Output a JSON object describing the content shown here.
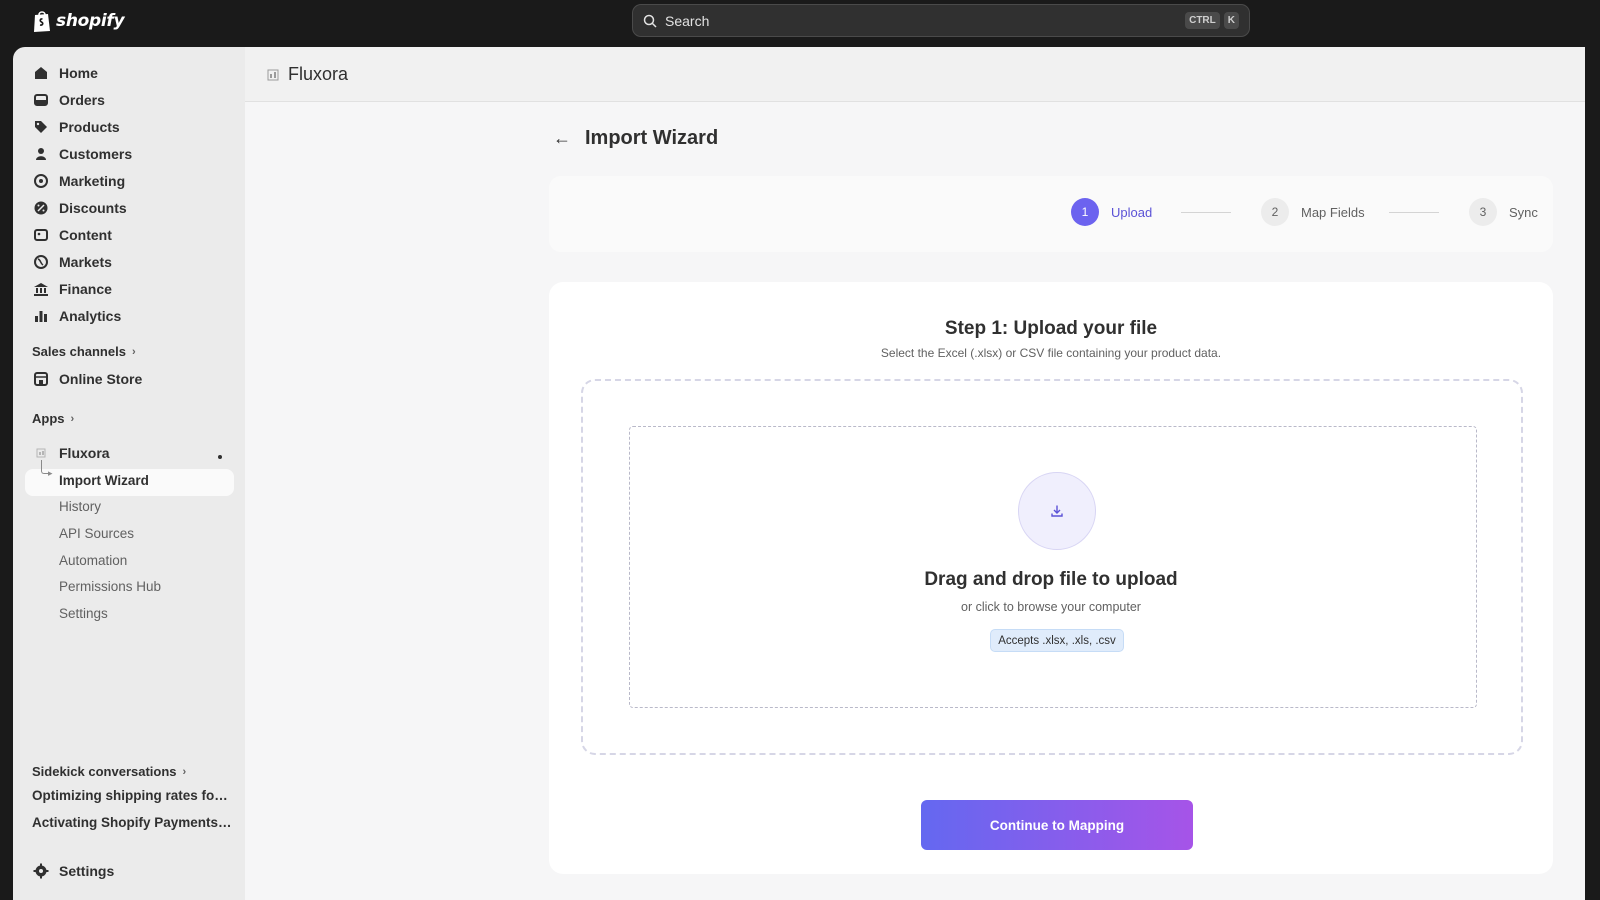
{
  "topbar": {
    "logo_text": "shopify",
    "search_placeholder": "Search",
    "shortcut_keys": [
      "CTRL",
      "K"
    ]
  },
  "sidebar": {
    "nav": [
      {
        "label": "Home",
        "icon": "home-icon"
      },
      {
        "label": "Orders",
        "icon": "orders-icon"
      },
      {
        "label": "Products",
        "icon": "tag-icon"
      },
      {
        "label": "Customers",
        "icon": "person-icon"
      },
      {
        "label": "Marketing",
        "icon": "target-icon"
      },
      {
        "label": "Discounts",
        "icon": "discount-icon"
      },
      {
        "label": "Content",
        "icon": "content-icon"
      },
      {
        "label": "Markets",
        "icon": "globe-icon"
      },
      {
        "label": "Finance",
        "icon": "bank-icon"
      },
      {
        "label": "Analytics",
        "icon": "bar-chart-icon"
      }
    ],
    "sales_channels_label": "Sales channels",
    "online_store_label": "Online Store",
    "apps_label": "Apps",
    "app_name": "Fluxora",
    "app_subitems": [
      "Import Wizard",
      "History",
      "API Sources",
      "Automation",
      "Permissions Hub",
      "Settings"
    ],
    "sidekick_label": "Sidekick conversations",
    "sidekick_items": [
      "Optimizing shipping rates for s...",
      "Activating Shopify Payments f..."
    ],
    "settings_label": "Settings"
  },
  "app_header": {
    "title": "Fluxora"
  },
  "page": {
    "title": "Import Wizard"
  },
  "stepper": {
    "steps": [
      {
        "num": "1",
        "label": "Upload",
        "active": true
      },
      {
        "num": "2",
        "label": "Map Fields",
        "active": false
      },
      {
        "num": "3",
        "label": "Sync",
        "active": false
      }
    ]
  },
  "upload": {
    "title": "Step 1: Upload your file",
    "subtitle": "Select the Excel (.xlsx) or CSV file containing your product data.",
    "drop_title": "Drag and drop file to upload",
    "drop_subtitle": "or click to browse your computer",
    "accepts": "Accepts .xlsx, .xls, .csv",
    "continue_label": "Continue to Mapping"
  },
  "colors": {
    "accent": "#6c63ef",
    "button_gradient_start": "#6468f0",
    "button_gradient_end": "#a654e8",
    "topbar": "#1a1a1a"
  }
}
